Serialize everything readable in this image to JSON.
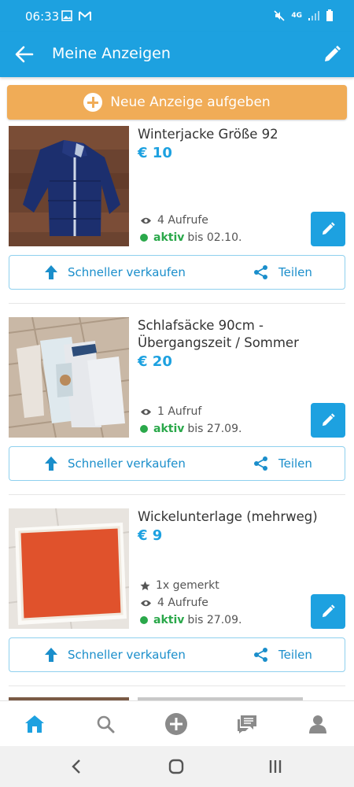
{
  "status_bar": {
    "time": "06:33",
    "network": "4G"
  },
  "app_bar": {
    "title": "Meine Anzeigen"
  },
  "new_ad_button": {
    "label": "Neue Anzeige aufgeben"
  },
  "listings": [
    {
      "title": "Winterjacke Größe 92",
      "price": "€ 10",
      "watched": "",
      "views": "4 Aufrufe",
      "status": "aktiv",
      "until": "bis 02.10.",
      "sell_label": "Schneller verkaufen",
      "share_label": "Teilen"
    },
    {
      "title": "Schlafsäcke 90cm - Übergangszeit / Sommer",
      "price": "€ 20",
      "watched": "",
      "views": "1 Aufruf",
      "status": "aktiv",
      "until": "bis 27.09.",
      "sell_label": "Schneller verkaufen",
      "share_label": "Teilen"
    },
    {
      "title": "Wickelunterlage (mehrweg)",
      "price": "€ 9",
      "watched": "1x gemerkt",
      "views": "4 Aufrufe",
      "status": "aktiv",
      "until": "bis 27.09.",
      "sell_label": "Schneller verkaufen",
      "share_label": "Teilen"
    }
  ],
  "bottom_nav": [
    "home-icon",
    "search-icon",
    "add-icon",
    "messages-icon",
    "profile-icon"
  ],
  "colors": {
    "primary": "#1da1e0",
    "accent": "#f0ac57",
    "active": "#2aa84a"
  }
}
